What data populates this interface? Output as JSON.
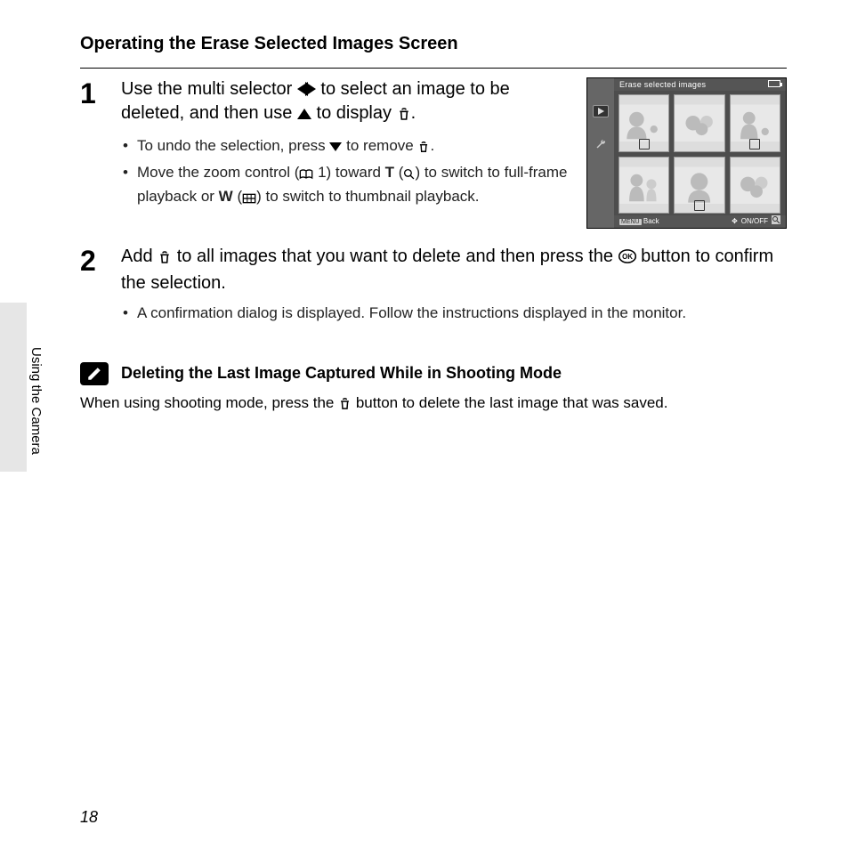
{
  "heading": "Operating the Erase Selected Images Screen",
  "side_label": "Using the Camera",
  "page_number": "18",
  "step1": {
    "number": "1",
    "text_a": "Use the multi selector ",
    "text_b": " to select an image to be deleted, and then use ",
    "text_c": " to display ",
    "text_d": ".",
    "bullet1_a": "To undo the selection, press ",
    "bullet1_b": " to remove ",
    "bullet1_c": ".",
    "bullet2_a": "Move the zoom control (",
    "bullet2_page": " 1) toward ",
    "bullet2_t": "T",
    "bullet2_b": " (",
    "bullet2_c": ") to switch to full-frame playback or ",
    "bullet2_w": "W",
    "bullet2_d": " (",
    "bullet2_e": ") to switch to thumbnail playback."
  },
  "step2": {
    "number": "2",
    "text_a": "Add ",
    "text_b": " to all images that you want to delete and then press the ",
    "text_c": " button to confirm the selection.",
    "bullet1": "A confirmation dialog is displayed. Follow the instructions displayed in the monitor."
  },
  "note": {
    "title": "Deleting the Last Image Captured While in Shooting Mode",
    "body_a": "When using shooting mode, press the ",
    "body_b": " button to delete the last image that was saved."
  },
  "lcd": {
    "title": "Erase selected images",
    "back": "Back",
    "onoff": "ON/OFF"
  }
}
